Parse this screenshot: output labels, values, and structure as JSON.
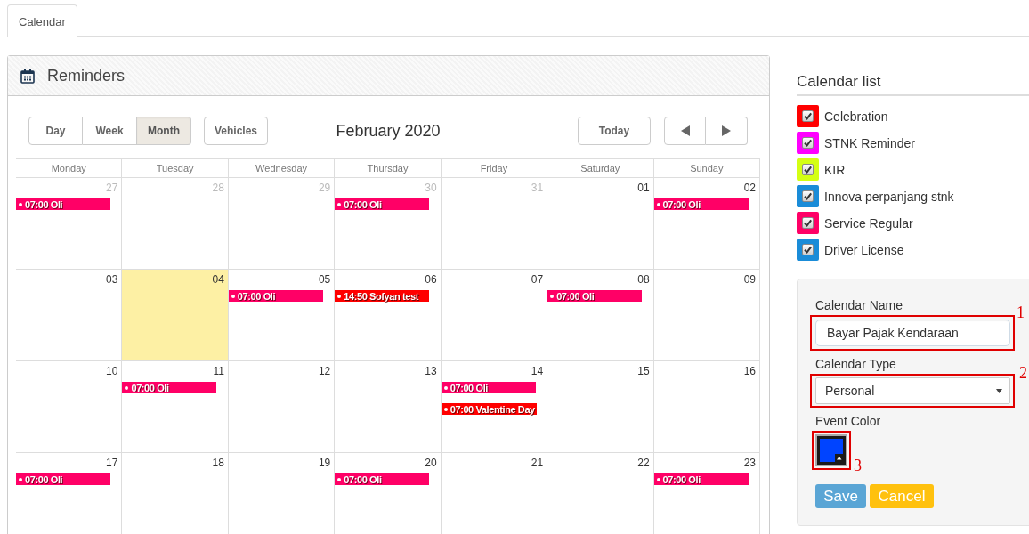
{
  "tabs": [
    {
      "label": "Calendar",
      "selected": true
    }
  ],
  "reminders": {
    "title": "Reminders",
    "views": [
      {
        "label": "Day",
        "selected": false
      },
      {
        "label": "Week",
        "selected": false
      },
      {
        "label": "Month",
        "selected": true
      }
    ],
    "filter_button": "Vehicles",
    "period_title": "February 2020",
    "today_button": "Today",
    "weekdays": [
      "Monday",
      "Tuesday",
      "Wednesday",
      "Thursday",
      "Friday",
      "Saturday",
      "Sunday"
    ],
    "weeks": [
      {
        "days": [
          {
            "day": "27",
            "other_month": true,
            "today": false,
            "events": [
              {
                "text": "07:00 Oli",
                "color": "#ff0066"
              }
            ]
          },
          {
            "day": "28",
            "other_month": true,
            "today": false
          },
          {
            "day": "29",
            "other_month": true,
            "today": false
          },
          {
            "day": "30",
            "other_month": true,
            "today": false,
            "events": [
              {
                "text": "07:00 Oli",
                "color": "#ff0066"
              }
            ]
          },
          {
            "day": "31",
            "other_month": true,
            "today": false
          },
          {
            "day": "01",
            "other_month": false,
            "today": false
          },
          {
            "day": "02",
            "other_month": false,
            "today": false,
            "events": [
              {
                "text": "07:00 Oli",
                "color": "#ff0066"
              }
            ]
          }
        ]
      },
      {
        "days": [
          {
            "day": "03",
            "other_month": false,
            "today": false
          },
          {
            "day": "04",
            "other_month": false,
            "today": true
          },
          {
            "day": "05",
            "other_month": false,
            "today": false,
            "events": [
              {
                "text": "07:00 Oli",
                "color": "#ff0066"
              }
            ]
          },
          {
            "day": "06",
            "other_month": false,
            "today": false,
            "events": [
              {
                "text": "14:50 Sofyan test",
                "color": "#ff0000"
              }
            ]
          },
          {
            "day": "07",
            "other_month": false,
            "today": false
          },
          {
            "day": "08",
            "other_month": false,
            "today": false,
            "events": [
              {
                "text": "07:00 Oli",
                "color": "#ff0066"
              }
            ]
          },
          {
            "day": "09",
            "other_month": false,
            "today": false
          }
        ]
      },
      {
        "days": [
          {
            "day": "10",
            "other_month": false,
            "today": false
          },
          {
            "day": "11",
            "other_month": false,
            "today": false,
            "events": [
              {
                "text": "07:00 Oli",
                "color": "#ff0066"
              }
            ]
          },
          {
            "day": "12",
            "other_month": false,
            "today": false
          },
          {
            "day": "13",
            "other_month": false,
            "today": false
          },
          {
            "day": "14",
            "other_month": false,
            "today": false,
            "events": [
              {
                "text": "07:00 Oli",
                "color": "#ff0066"
              },
              {
                "text": "07:00 Valentine Day",
                "color": "#ff0000"
              }
            ]
          },
          {
            "day": "15",
            "other_month": false,
            "today": false
          },
          {
            "day": "16",
            "other_month": false,
            "today": false
          }
        ]
      },
      {
        "days": [
          {
            "day": "17",
            "other_month": false,
            "today": false,
            "events": [
              {
                "text": "07:00 Oli",
                "color": "#ff0066"
              }
            ]
          },
          {
            "day": "18",
            "other_month": false,
            "today": false
          },
          {
            "day": "19",
            "other_month": false,
            "today": false
          },
          {
            "day": "20",
            "other_month": false,
            "today": false,
            "events": [
              {
                "text": "07:00 Oli",
                "color": "#ff0066"
              }
            ]
          },
          {
            "day": "21",
            "other_month": false,
            "today": false
          },
          {
            "day": "22",
            "other_month": false,
            "today": false
          },
          {
            "day": "23",
            "other_month": false,
            "today": false,
            "events": [
              {
                "text": "07:00 Oli",
                "color": "#ff0066"
              }
            ]
          }
        ]
      }
    ]
  },
  "calendar_list": {
    "title": "Calendar list",
    "items": [
      {
        "label": "Celebration",
        "color": "#ff0000",
        "checked": true
      },
      {
        "label": "STNK Reminder",
        "color": "#ff00ff",
        "checked": true
      },
      {
        "label": "KIR",
        "color": "#d4ff14",
        "checked": true
      },
      {
        "label": "Innova perpanjang stnk",
        "color": "#1a8cd8",
        "checked": true
      },
      {
        "label": "Service Regular",
        "color": "#ff0066",
        "checked": true
      },
      {
        "label": "Driver License",
        "color": "#1a8cd8",
        "checked": true
      }
    ]
  },
  "calendar_form": {
    "fields": [
      {
        "kind": "text",
        "label": "Calendar Name",
        "value": "Bayar Pajak Kendaraan",
        "annotation": "1"
      },
      {
        "kind": "select",
        "label": "Calendar Type",
        "value": "Personal",
        "annotation": "2"
      },
      {
        "kind": "color",
        "label": "Event Color",
        "color": "#0044ff",
        "annotation": "3"
      }
    ],
    "buttons": [
      {
        "kind": "primary",
        "label": "Save"
      },
      {
        "kind": "warning",
        "label": "Cancel"
      }
    ]
  }
}
